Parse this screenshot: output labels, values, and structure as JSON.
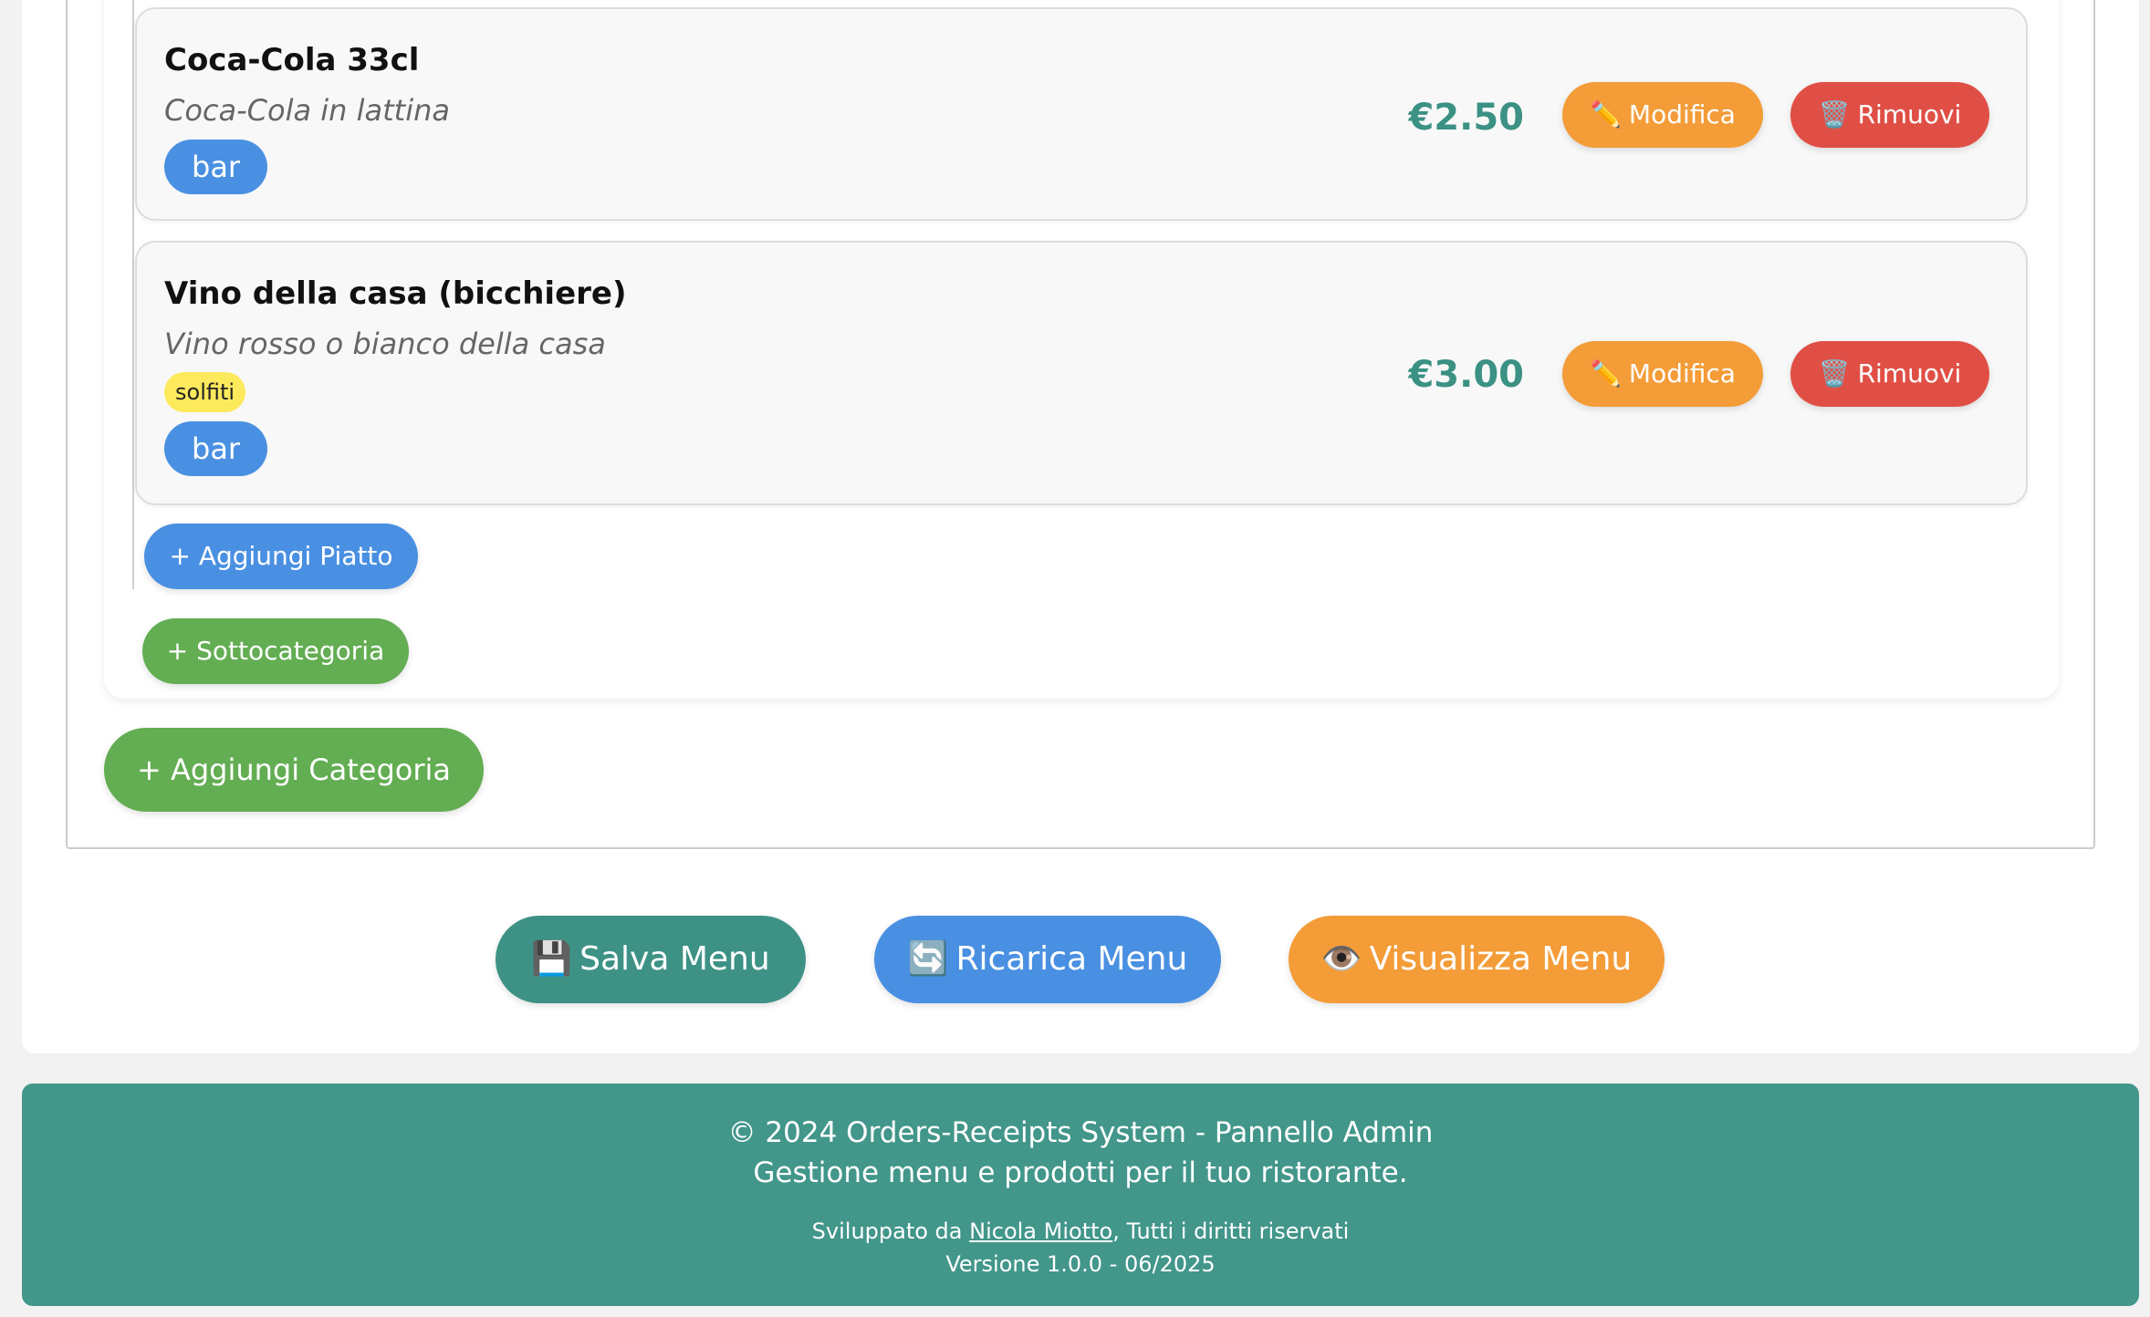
{
  "items": [
    {
      "name": "Coca-Cola 33cl",
      "description": "Coca-Cola in lattina",
      "allergens": [],
      "tag": "bar",
      "price": "€2.50"
    },
    {
      "name": "Vino della casa (bicchiere)",
      "description": "Vino rosso o bianco della casa",
      "allergens": [
        "solfiti"
      ],
      "tag": "bar",
      "price": "€3.00"
    }
  ],
  "buttons": {
    "edit_icon": "✏️",
    "edit_label": "Modifica",
    "remove_icon": "🗑️",
    "remove_label": "Rimuovi",
    "add_dish": "+ Aggiungi Piatto",
    "add_subcategory": "+ Sottocategoria",
    "add_category": "+ Aggiungi Categoria",
    "save_icon": "💾",
    "save_label": "Salva Menu",
    "reload_icon": "🔄",
    "reload_label": "Ricarica Menu",
    "view_icon": "👁️",
    "view_label": "Visualizza Menu"
  },
  "footer": {
    "copyright": "© 2024 Orders-Receipts System - Pannello Admin",
    "tagline": "Gestione menu e prodotti per il tuo ristorante.",
    "dev_prefix": "Sviluppato da ",
    "dev_name": "Nicola Miotto",
    "dev_suffix": ", Tutti i diritti riservati",
    "version": "Versione 1.0.0 - 06/2025"
  },
  "colors": {
    "teal": "#3d9285",
    "blue": "#4a90e2",
    "green": "#63ad52",
    "orange": "#f39c38",
    "red": "#e04f45",
    "allergen_yellow": "#fde95c",
    "footer_bg": "#42968a"
  }
}
